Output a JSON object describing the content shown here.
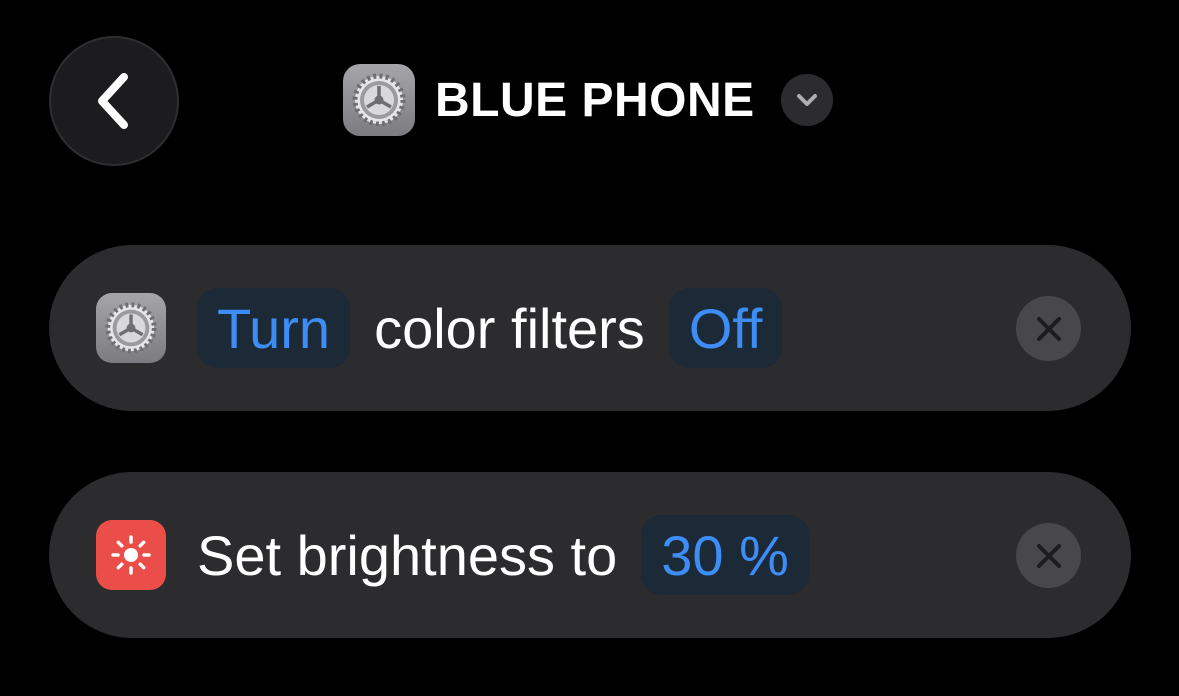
{
  "header": {
    "back_icon": "chevron-left-icon",
    "app_icon": "settings-gear-icon",
    "device_name": "BLUE PHONE",
    "dropdown_icon": "chevron-down-icon"
  },
  "actions": [
    {
      "icon": "settings-gear-icon",
      "icon_color": "#8e8e93",
      "parts": [
        {
          "type": "token",
          "text": "Turn"
        },
        {
          "type": "text",
          "text": "color filters"
        },
        {
          "type": "token",
          "text": "Off"
        }
      ],
      "remove_icon": "close-icon"
    },
    {
      "icon": "sun-icon",
      "icon_color": "#eb4e49",
      "parts": [
        {
          "type": "text",
          "text": "Set brightness to"
        },
        {
          "type": "token",
          "text": "30 %"
        }
      ],
      "remove_icon": "close-icon"
    }
  ],
  "colors": {
    "background": "#000000",
    "card": "#2c2c2e",
    "accent": "#3d8df5",
    "token_background": "#1c2937"
  }
}
